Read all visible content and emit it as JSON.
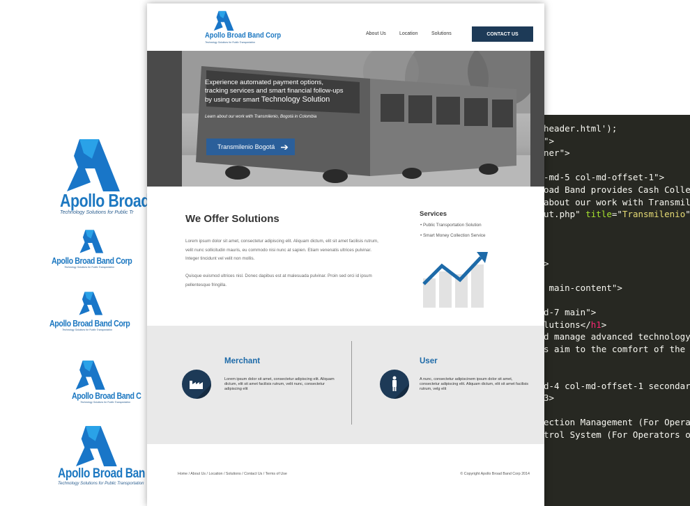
{
  "code_lines": [
    {
      "t": "header.html');",
      "cls": ""
    },
    {
      "t": "\">",
      "cls": ""
    },
    {
      "t": "ner\">",
      "cls": ""
    },
    {
      "t": "",
      "cls": ""
    },
    {
      "t": "-md-5 col-md-offset-1\">",
      "cls": ""
    },
    {
      "t": "oad Band provides Cash Collec",
      "cls": ""
    },
    {
      "t": "about our work with Transmiler",
      "cls": ""
    },
    {
      "t": "ut.php\" title=\"Transmilenio\"",
      "cls": ""
    },
    {
      "t": "",
      "cls": ""
    },
    {
      "t": "",
      "cls": ""
    },
    {
      "t": "",
      "cls": ""
    },
    {
      "t": ">",
      "cls": ""
    },
    {
      "t": "",
      "cls": ""
    },
    {
      "t": " main-content\">",
      "cls": ""
    },
    {
      "t": "",
      "cls": ""
    },
    {
      "t": "d-7 main\">",
      "cls": ""
    },
    {
      "t": "lutions</h1>",
      "cls": ""
    },
    {
      "t": "d manage advanced technology",
      "cls": ""
    },
    {
      "t": "s aim to the comfort of the c",
      "cls": ""
    },
    {
      "t": "",
      "cls": ""
    },
    {
      "t": "",
      "cls": ""
    },
    {
      "t": "d-4 col-md-offset-1 secondary",
      "cls": ""
    },
    {
      "t": "3>",
      "cls": ""
    },
    {
      "t": "",
      "cls": ""
    },
    {
      "t": "ection Management (For Operat",
      "cls": ""
    },
    {
      "t": "trol System (For Operators o",
      "cls": ""
    }
  ],
  "logos": {
    "name": "Apollo Broad Band Corp",
    "name_trunc_1": "Apollo Broad",
    "name_trunc_2": "Apollo Broad Band C",
    "name_trunc_3": "Apollo Broad Ban",
    "tagline": "Technology Solutions for Public Transportation",
    "tagline_trunc_1": "Technology Solutions for Public Tr",
    "tagline_trunc_3": "Technology Solutions for Public Transportation"
  },
  "nav": {
    "brand_name": "Apollo Broad Band Corp",
    "brand_tagline": "Technology Solutions for Public Transportation",
    "about": "About Us",
    "location": "Location",
    "solutions": "Solutions",
    "contact": "CONTACT US"
  },
  "hero": {
    "line1": "Experience automated payment options,",
    "line2": "tracking services and smart financial follow-ups",
    "line3": "by using our smart ",
    "line3_big": "Technology Solution",
    "sub": "Learn about our work with Transmilenio, Bogotá in Colombia",
    "button": "Transmilenio Bogotá"
  },
  "solutions": {
    "title": "We Offer Solutions",
    "p1": "Lorem ipsum dolor sit amet, consectetur adipiscing elit. Aliquam dictum, elit sit amet facilisis rutrum, velit nunc sollicitudin mauris, eu commodo nisi nunc at sapien. Etiam venenatis ultrices pulvinar. Integer tincidunt vel velit non mollis.",
    "p2": " Quisque euismod ultrices nisl. Donec dapibus est at malesuada pulvinar. Proin sed orci id ipsum pellentesque fringilla.",
    "services_title": "Services",
    "service1": "• Public Transportation Solution",
    "service2": "• Smart Money Collection Service"
  },
  "band": {
    "merchant_title": "Merchant",
    "merchant_text": "Lorem ipsum dolor sit amet, consectetur adipiscing elit. Aliquam dictum, elit sit amet facilisis rutrum, velit nunc, consectetur adipiscing elit",
    "user_title": "User",
    "user_text": "A nunc, consectetur adipiscinem ipsum dolor sit amet, consectetur adipiscing elit. Aliquam dictum, elit sit amet facilisis rutrum, velg elit"
  },
  "footer": {
    "links": "Home / About Us / Location / Solutions / Contact Us / Terms of Use",
    "copyright": "© Copyright Apollo Broad Band Corp 2014"
  },
  "colors": {
    "brand": "#1d78c1",
    "navy": "#1d3a57",
    "code_bg": "#272822"
  }
}
